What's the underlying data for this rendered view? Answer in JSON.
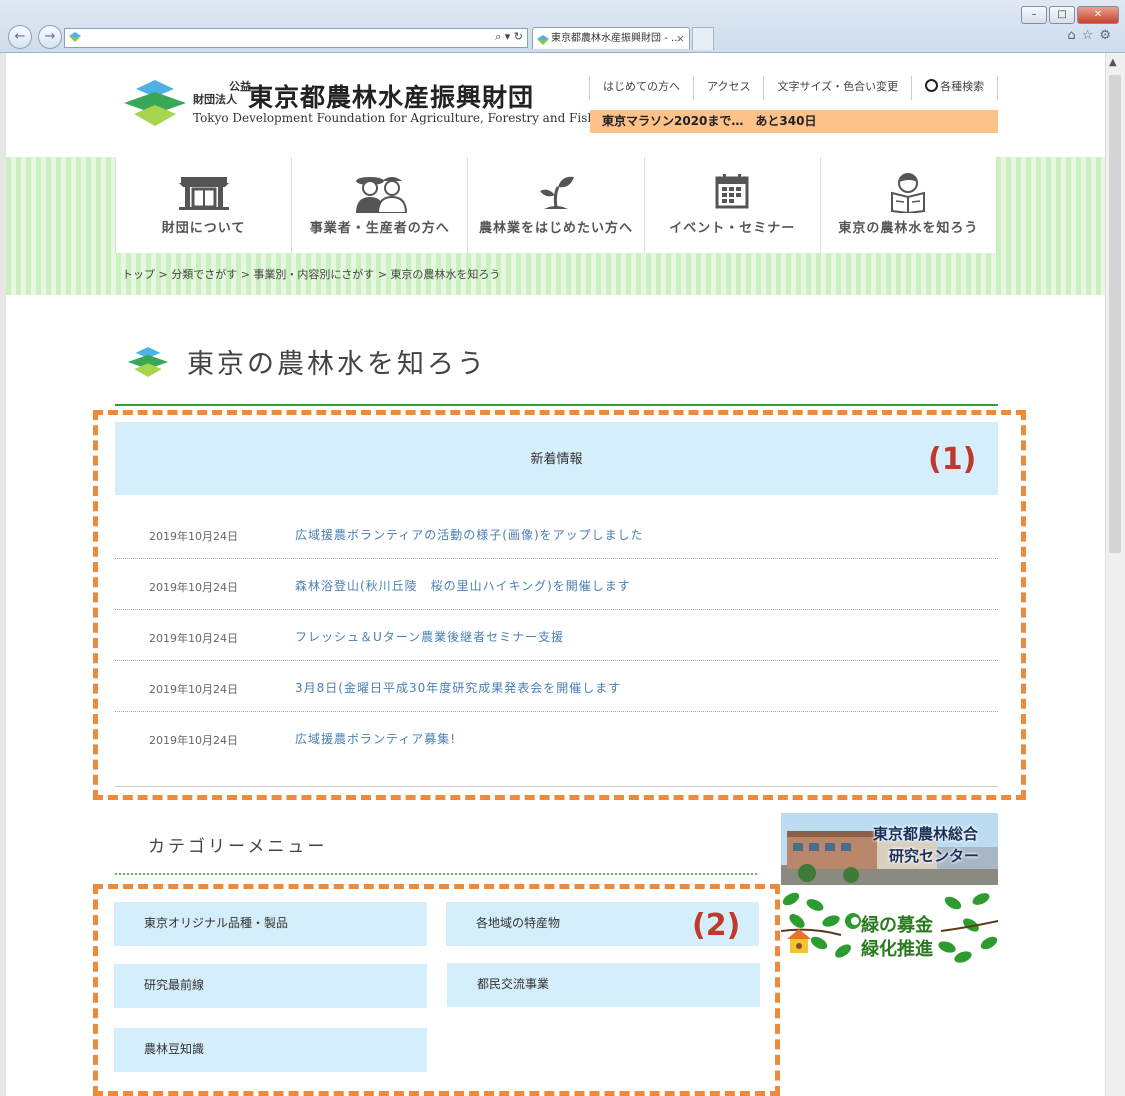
{
  "browser": {
    "tab_title": "東京都農林水産振興財団 - ...",
    "tab_close": "×",
    "address_tools": "⌕ ▾ ↻",
    "icons": [
      "back-icon",
      "forward-icon",
      "home-icon",
      "star-icon",
      "gear-icon"
    ]
  },
  "header": {
    "org_prefix_1": "公益",
    "org_prefix_2": "財団法人",
    "org_name": "東京都農林水産振興財団",
    "org_name_en": "Tokyo Development Foundation for Agriculture, Forestry and Fisheries",
    "links": [
      "はじめての方へ",
      "アクセス",
      "文字サイズ・色合い変更",
      "各種検索"
    ],
    "countdown": "東京マラソン2020まで…　あと340日"
  },
  "nav": {
    "items": [
      {
        "label": "財団について",
        "icon": "building-icon"
      },
      {
        "label": "事業者・生産者の方へ",
        "icon": "farmers-icon"
      },
      {
        "label": "農林業をはじめたい方へ",
        "icon": "sprout-icon"
      },
      {
        "label": "イベント・セミナー",
        "icon": "calendar-icon"
      },
      {
        "label": "東京の農林水を知ろう",
        "icon": "reader-icon"
      }
    ]
  },
  "breadcrumb": "トップ > 分類でさがす > 事業別・内容別にさがす > 東京の農林水を知ろう",
  "page": {
    "title": "東京の農林水を知ろう"
  },
  "news": {
    "heading": "新着情報",
    "marker": "(1)",
    "items": [
      {
        "date": "2019年10月24日",
        "title": "広域援農ボランティアの活動の様子(画像)をアップしました"
      },
      {
        "date": "2019年10月24日",
        "title": "森林浴登山(秋川丘陵　桜の里山ハイキング)を開催します"
      },
      {
        "date": "2019年10月24日",
        "title": "フレッシュ＆Uターン農業後継者セミナー支援"
      },
      {
        "date": "2019年10月24日",
        "title": "3月8日(金曜日平成30年度研究成果発表会を開催します"
      },
      {
        "date": "2019年10月24日",
        "title": "広域援農ボランティア募集!"
      }
    ]
  },
  "category": {
    "title": "カテゴリーメニュー",
    "marker": "(2)",
    "items": [
      "東京オリジナル品種・製品",
      "各地域の特産物",
      "研究最前線",
      "都民交流事業",
      "農林豆知識"
    ]
  },
  "banners": {
    "research_title": "東京都農林総合",
    "research_sub": "研究センター",
    "fund_title": "緑の募金",
    "fund_sub": "緑化推進"
  },
  "colors": {
    "accent_green": "#2fa136",
    "highlight_orange": "#fdc18a",
    "dash_orange": "#ef8a3a",
    "light_blue": "#d5eefb",
    "link_blue": "#4a7fb5",
    "marker_red": "#c0392b"
  }
}
